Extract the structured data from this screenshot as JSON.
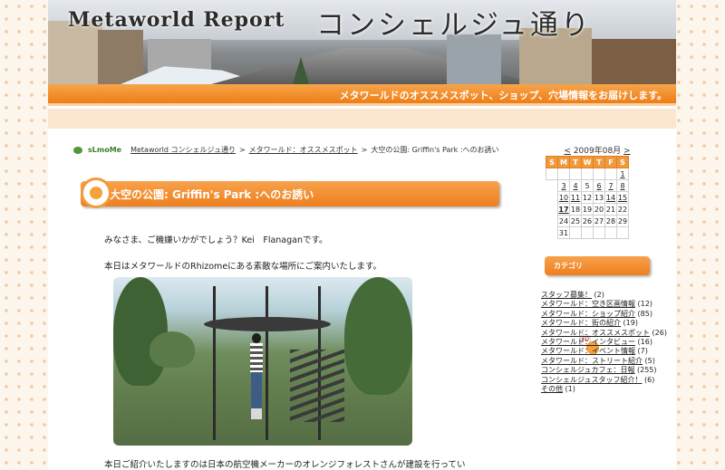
{
  "header": {
    "title_en": "Metaworld Report",
    "title_jp": "コンシェルジュ通り",
    "tagline": "メタワールドのオススメスポット、ショップ、穴場情報をお届けします。"
  },
  "breadcrumb": {
    "logo": "sLmoMe",
    "items": [
      "Metaworld コンシェルジュ通り",
      "メタワールド：オススメスポット"
    ],
    "separator": ">",
    "current": "大空の公園: Griffin's Park :へのお誘い"
  },
  "post": {
    "title": "大空の公園: Griffin's Park :へのお誘い",
    "paragraphs": [
      "みなさま、ご機嫌いかがでしょう？Kei　Flanaganです。",
      "本日はメタワールドのRhizomeにある素敵な場所にご案内いたします。",
      "本日ご紹介いたしますのは日本の航空機メーカーのオレンジフォレストさんが建設を行ってい"
    ]
  },
  "calendar": {
    "prev": "<",
    "next": ">",
    "month_label": "2009年08月",
    "weekdays": [
      "S",
      "M",
      "T",
      "W",
      "T",
      "F",
      "S"
    ],
    "weeks": [
      [
        "",
        "",
        "",
        "",
        "",
        "",
        "1"
      ],
      [
        "2",
        "3",
        "4",
        "5",
        "6",
        "7",
        "8"
      ],
      [
        "9",
        "10",
        "11",
        "12",
        "13",
        "14",
        "15"
      ],
      [
        "16",
        "17",
        "18",
        "19",
        "20",
        "21",
        "22"
      ],
      [
        "23",
        "24",
        "25",
        "26",
        "27",
        "28",
        "29"
      ],
      [
        "30",
        "31",
        "",
        "",
        "",
        "",
        ""
      ]
    ],
    "linked_days": [
      "1",
      "2",
      "3",
      "4",
      "6",
      "7",
      "8",
      "9",
      "10",
      "11",
      "14",
      "15",
      "16",
      "17"
    ],
    "today": "17"
  },
  "categories": {
    "heading": "カテゴリ",
    "items": [
      {
        "label": "スタッフ募集！",
        "count": "(2)"
      },
      {
        "label": "メタワールド：空き区画情報",
        "count": "(12)"
      },
      {
        "label": "メタワールド：ショップ紹介",
        "count": "(85)"
      },
      {
        "label": "メタワールド：街の紹介",
        "count": "(19)"
      },
      {
        "label": "メタワールド：オススメスポット",
        "count": "(26)"
      },
      {
        "label": "メタワールド：インタビュー",
        "count": "(16)"
      },
      {
        "label": "メタワールド：イベント情報",
        "count": "(7)"
      },
      {
        "label": "メタワールド：ストリート紹介",
        "count": "(5)"
      },
      {
        "label": "コンシェルジュカフェ：日報",
        "count": "(255)"
      },
      {
        "label": "コンシェルジュスタッフ紹介！",
        "count": "(6)"
      },
      {
        "label": "その他",
        "count": "(1)"
      }
    ]
  },
  "colors": {
    "accent": "#ef7f1e",
    "background": "#fdf6ec",
    "sunday": "#d0261e"
  }
}
